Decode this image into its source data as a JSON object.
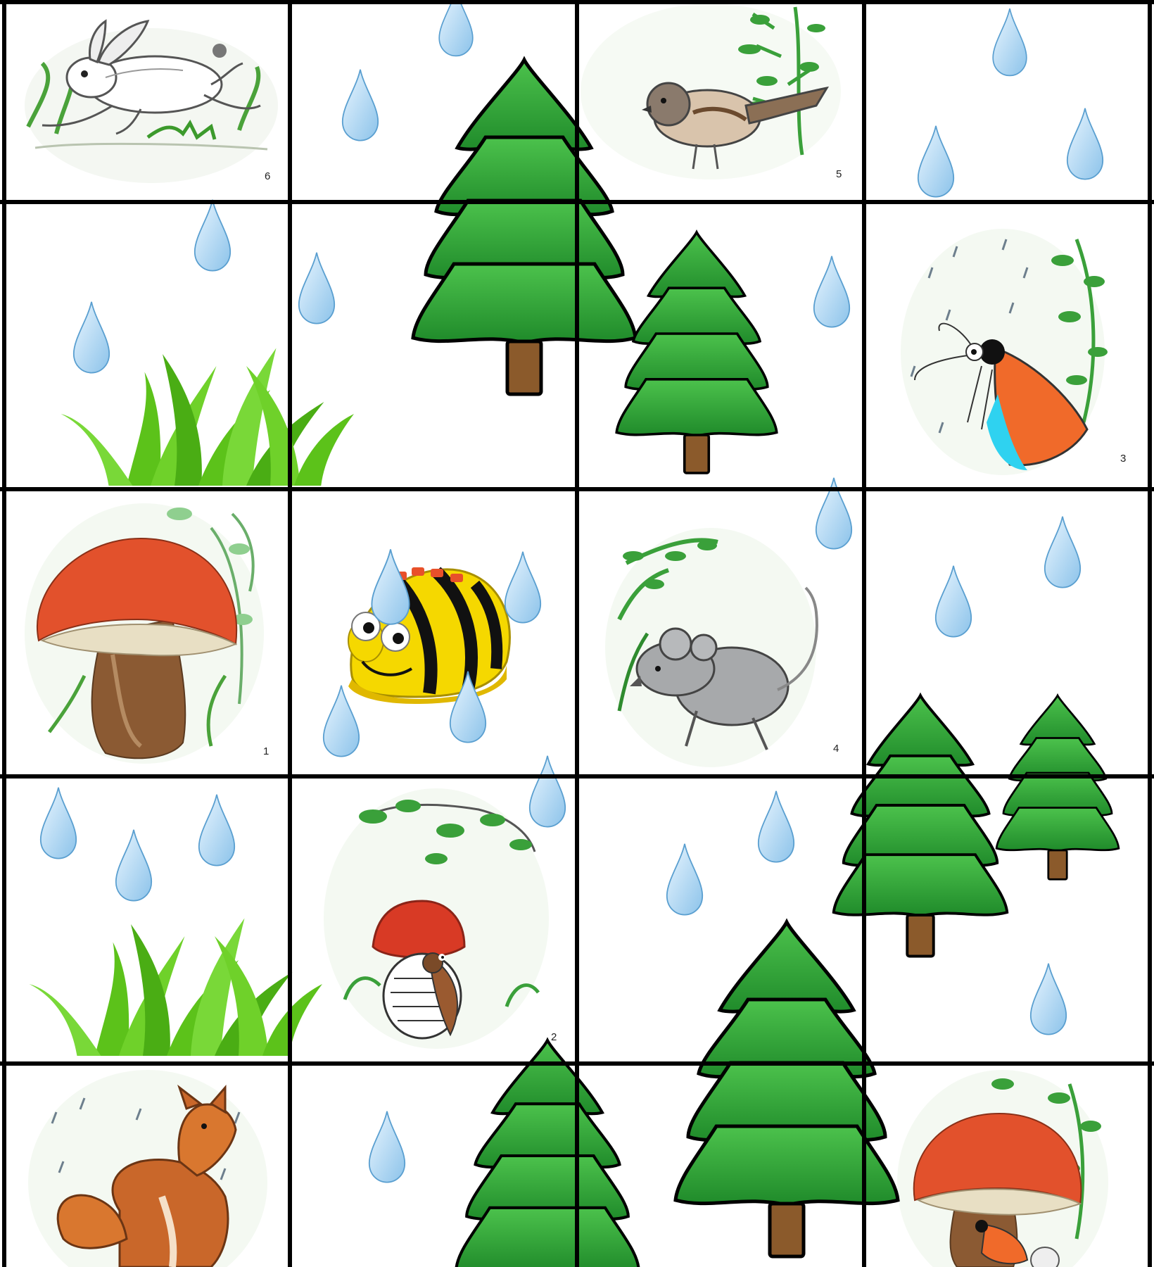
{
  "board": {
    "columns": 4,
    "rows": 5,
    "background": "#ffffff",
    "grid_color": "#000000",
    "colors": {
      "tree_green": "#2e9e2e",
      "tree_dark": "#1e7a1e",
      "trunk": "#8b5a2b",
      "raindrop": "#a8d4f0",
      "raindrop_edge": "#5a9fd0",
      "grass": "#5cc21a",
      "mushroom_cap": "#e2512c",
      "mushroom_stem": "#8b5a33",
      "robot_yellow": "#f5d800"
    }
  },
  "cells": [
    {
      "row": 0,
      "col": 0,
      "picture": "hare-icon",
      "number": "6"
    },
    {
      "row": 0,
      "col": 2,
      "picture": "sparrow-icon",
      "number": "5"
    },
    {
      "row": 1,
      "col": 3,
      "picture": "butterfly-icon",
      "number": "3"
    },
    {
      "row": 2,
      "col": 0,
      "picture": "mushroom-icon",
      "number": "1"
    },
    {
      "row": 2,
      "col": 1,
      "picture": "bee-bot-icon",
      "number": ""
    },
    {
      "row": 2,
      "col": 2,
      "picture": "mouse-icon",
      "number": "4"
    },
    {
      "row": 3,
      "col": 1,
      "picture": "beetle-under-mushroom-icon",
      "number": "2"
    },
    {
      "row": 4,
      "col": 0,
      "picture": "fox-icon",
      "number": ""
    },
    {
      "row": 4,
      "col": 3,
      "picture": "butterfly-under-mushroom-icon",
      "number": ""
    }
  ]
}
